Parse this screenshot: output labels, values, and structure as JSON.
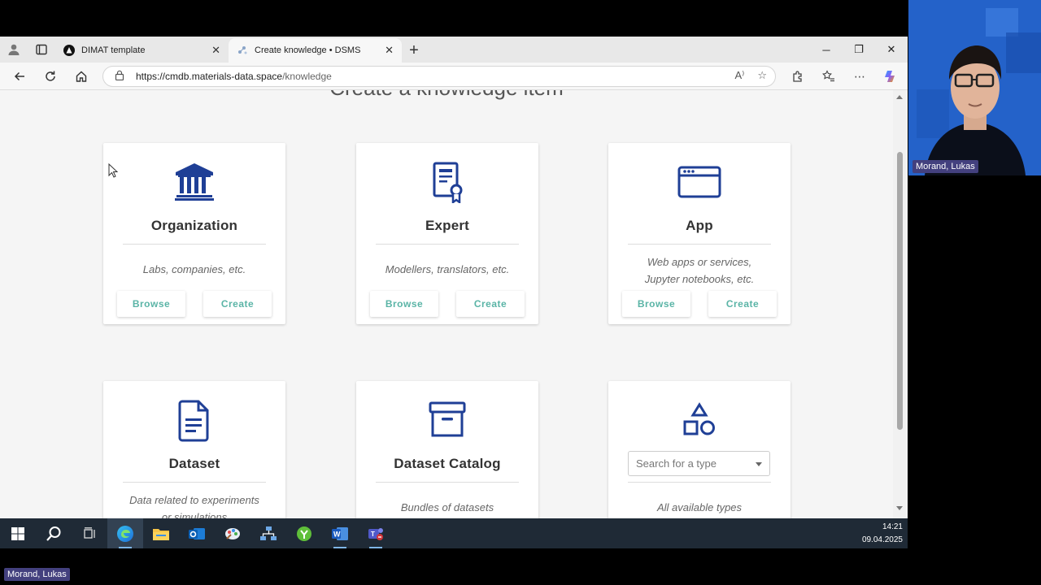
{
  "browser": {
    "tabs": [
      {
        "title": "DIMAT template",
        "active": false
      },
      {
        "title": "Create knowledge • DSMS",
        "active": true
      }
    ],
    "url_host": "https://cmdb.materials-data.space",
    "url_path": "/knowledge"
  },
  "page": {
    "heading": "Create a knowledge item",
    "cards": [
      {
        "title": "Organization",
        "icon": "institution-icon",
        "desc_lines": [
          "Labs, companies, etc."
        ],
        "browse": "Browse",
        "create": "Create"
      },
      {
        "title": "Expert",
        "icon": "certificate-icon",
        "desc_lines": [
          "Modellers, translators, etc."
        ],
        "browse": "Browse",
        "create": "Create"
      },
      {
        "title": "App",
        "icon": "browser-window-icon",
        "desc_lines": [
          "Web apps or services,",
          "Jupyter notebooks, etc."
        ],
        "browse": "Browse",
        "create": "Create"
      },
      {
        "title": "Dataset",
        "icon": "document-icon",
        "desc_lines": [
          "Data related to experiments",
          "or simulations"
        ]
      },
      {
        "title": "Dataset Catalog",
        "icon": "archive-box-icon",
        "desc_lines": [
          "Bundles of datasets"
        ]
      },
      {
        "icon": "shapes-icon",
        "search_placeholder": "Search for a type",
        "desc_lines": [
          "All available types"
        ]
      }
    ]
  },
  "taskbar": {
    "time": "14:21",
    "date": "09.04.2025"
  },
  "participants": {
    "video_name": "Morand, Lukas",
    "bottom_name": "Morand, Lukas"
  },
  "colors": {
    "icon_blue": "#1f3f96",
    "button_teal": "#5ab4a6",
    "taskbar": "#1f2a36",
    "teams_nametag": "#43407e"
  }
}
